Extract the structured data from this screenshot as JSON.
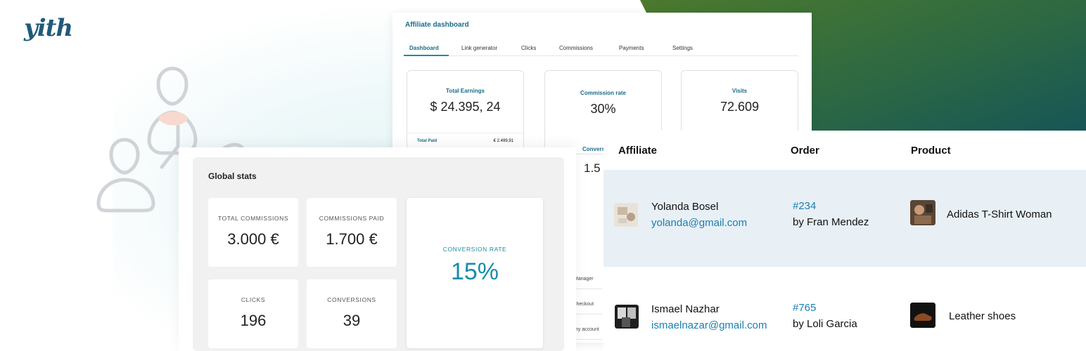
{
  "brand": {
    "logo_text": "yith",
    "accent": "#1a8ca8",
    "dark": "#0b3d5a"
  },
  "dashboard": {
    "title": "Affiliate dashboard",
    "tabs": [
      "Dashboard",
      "Link generator",
      "Clicks",
      "Commissions",
      "Payments",
      "Settings"
    ],
    "cards": [
      {
        "label": "Total Earnings",
        "value": "$ 24.395, 24",
        "sub_label": "Total Paid",
        "sub_value": "€ 2.499,91"
      },
      {
        "label": "Commission rate",
        "value": "30%"
      },
      {
        "label": "Visits",
        "value": "72.609"
      }
    ],
    "partial_label": "Convers",
    "partial_value": "1.5",
    "rows": [
      "Manager",
      "checkout",
      "my account"
    ]
  },
  "global_stats": {
    "title": "Global stats",
    "cards": [
      {
        "label": "TOTAL COMMISSIONS",
        "value": "3.000 €"
      },
      {
        "label": "COMMISSIONS PAID",
        "value": "1.700 €"
      },
      {
        "label": "CLICKS",
        "value": "196"
      },
      {
        "label": "CONVERSIONS",
        "value": "39"
      }
    ],
    "highlight": {
      "label": "CONVERSION RATE",
      "value": "15%"
    }
  },
  "orders_table": {
    "headers": [
      "Affiliate",
      "Order",
      "Product"
    ],
    "rows": [
      {
        "name": "Yolanda Bosel",
        "email": "yolanda@gmail.com",
        "order": "#234",
        "by": "by Fran Mendez",
        "product": "Adidas T-Shirt Woman"
      },
      {
        "name": "Ismael Nazhar",
        "email": "ismaelnazar@gmail.com",
        "order": "#765",
        "by": "by Loli Garcia",
        "product": "Leather shoes"
      }
    ]
  }
}
